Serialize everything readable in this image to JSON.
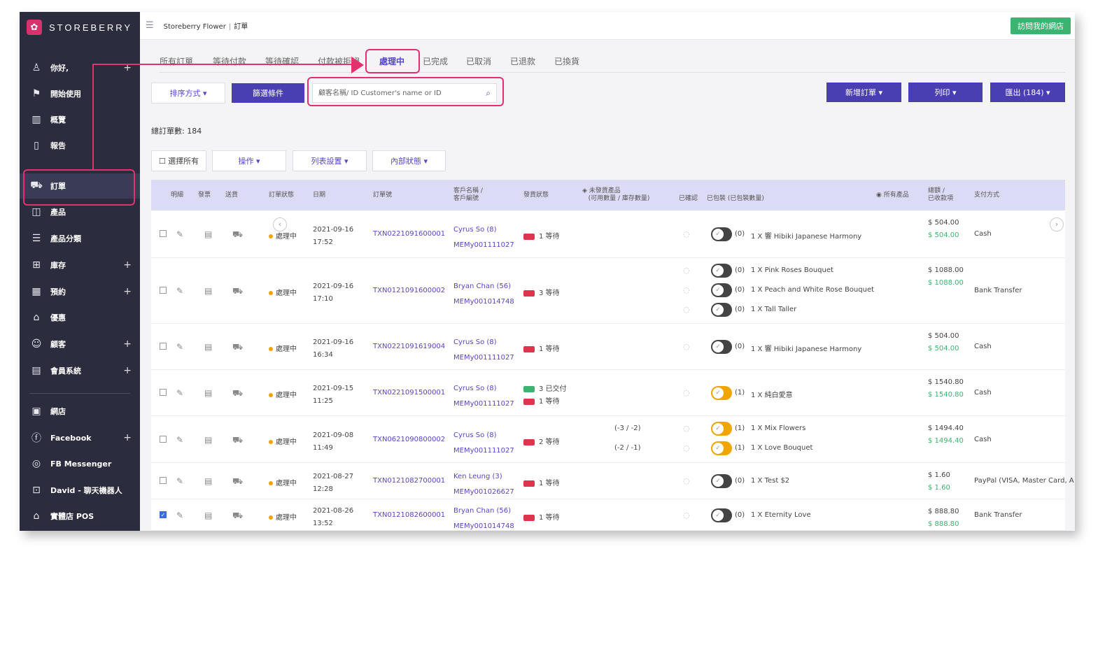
{
  "brand": {
    "name": "STOREBERRY",
    "logo_icon": "flower-logo"
  },
  "header": {
    "breadcrumb_store": "Storeberry Flower",
    "breadcrumb_page": "訂單",
    "visit_button": "訪問我的網店"
  },
  "sidebar": {
    "items": [
      {
        "label": "你好,",
        "icon": "user-icon",
        "plus": true
      },
      {
        "label": "開始使用",
        "icon": "flag-icon",
        "plus": false
      },
      {
        "label": "概覽",
        "icon": "chart-icon",
        "plus": false
      },
      {
        "label": "報告",
        "icon": "document-icon",
        "plus": false
      },
      {
        "label": "訂單",
        "icon": "cart-icon",
        "plus": false,
        "active": true
      },
      {
        "label": "產品",
        "icon": "bag-icon",
        "plus": false
      },
      {
        "label": "產品分類",
        "icon": "list-icon",
        "plus": false
      },
      {
        "label": "庫存",
        "icon": "boxes-icon",
        "plus": true
      },
      {
        "label": "預約",
        "icon": "calendar-icon",
        "plus": true
      },
      {
        "label": "優惠",
        "icon": "home-icon",
        "plus": false
      },
      {
        "label": "顧客",
        "icon": "customer-icon",
        "plus": true
      },
      {
        "label": "會員系統",
        "icon": "member-icon",
        "plus": true
      },
      {
        "label": "網店",
        "icon": "save-icon",
        "plus": false
      },
      {
        "label": "Facebook",
        "icon": "facebook-icon",
        "plus": true
      },
      {
        "label": "FB Messenger",
        "icon": "messenger-icon",
        "plus": false
      },
      {
        "label": "David - 聊天機器人",
        "icon": "robot-icon",
        "plus": false
      },
      {
        "label": "實體店 POS",
        "icon": "shop-icon",
        "plus": false
      }
    ]
  },
  "tabs": [
    {
      "label": "所有訂單"
    },
    {
      "label": "等待付款"
    },
    {
      "label": "等待確認"
    },
    {
      "label": "付款被拒絕"
    },
    {
      "label": "處理中",
      "active": true
    },
    {
      "label": "已完成"
    },
    {
      "label": "已取消"
    },
    {
      "label": "已退款"
    },
    {
      "label": "已換貨"
    }
  ],
  "toolbar": {
    "sort_label": "排序方式 ▾",
    "filter_label": "篩選條件",
    "search_placeholder": "顧客名稱/ ID Customer's name or ID",
    "new_order": "新增訂單 ▾",
    "print": "列印 ▾",
    "export": "匯出 (184) ▾"
  },
  "total_orders": "總訂單數: 184",
  "actions": {
    "select_all": "☐ 選擇所有",
    "operation": "操作 ▾",
    "list_settings": "列表設置 ▾",
    "internal_status": "內部狀態 ▾"
  },
  "table": {
    "headers": {
      "detail": "明細",
      "invoice": "發票",
      "delivery": "送貨",
      "status": "訂單狀態",
      "date": "日期",
      "order_no": "訂單號",
      "customer_1": "客戶名稱 /",
      "customer_2": "客戶編號",
      "shipping": "發貨狀態",
      "unshipped_1": "未發貨產品",
      "unshipped_2": "(可用數量 / 庫存數量)",
      "confirmed": "已確認",
      "packed": "已包裝 (已包裝數量)",
      "all_products": "所有產品",
      "total_1": "總額 /",
      "total_2": "已收款項",
      "payment": "支付方式"
    },
    "rows": [
      {
        "checked": false,
        "status": "處理中",
        "date": "2021-09-16",
        "time": "17:52",
        "order": "TXN0221091600001",
        "customer": "Cyrus So (8)",
        "member": "MEMy001111027",
        "ship": [
          {
            "text": "1 等待",
            "color": "red"
          }
        ],
        "items": [
          {
            "qty": "(0)",
            "name": "1 X 響 Hibiki Japanese Harmony",
            "on": false,
            "unshipped": ""
          }
        ],
        "total": "$ 504.00",
        "paid": "$ 504.00",
        "payment": "Cash"
      },
      {
        "checked": false,
        "status": "處理中",
        "date": "2021-09-16",
        "time": "17:10",
        "order": "TXN0121091600002",
        "customer": "Bryan Chan (56)",
        "member": "MEMy001014748",
        "ship": [
          {
            "text": "3 等待",
            "color": "red"
          }
        ],
        "items": [
          {
            "qty": "(0)",
            "name": "1 X Pink Roses Bouquet",
            "on": false,
            "unshipped": ""
          },
          {
            "qty": "(0)",
            "name": "1 X Peach and White Rose Bouquet",
            "on": false,
            "unshipped": ""
          },
          {
            "qty": "(0)",
            "name": "1 X Tall Taller",
            "on": false,
            "unshipped": ""
          }
        ],
        "total": "$ 1088.00",
        "paid": "$ 1088.00",
        "payment": "Bank Transfer"
      },
      {
        "checked": false,
        "status": "處理中",
        "date": "2021-09-16",
        "time": "16:34",
        "order": "TXN0221091619004",
        "customer": "Cyrus So (8)",
        "member": "MEMy001111027",
        "ship": [
          {
            "text": "1 等待",
            "color": "red"
          }
        ],
        "items": [
          {
            "qty": "(0)",
            "name": "1 X 響 Hibiki Japanese Harmony",
            "on": false,
            "unshipped": ""
          }
        ],
        "total": "$ 504.00",
        "paid": "$ 504.00",
        "payment": "Cash"
      },
      {
        "checked": false,
        "status": "處理中",
        "date": "2021-09-15",
        "time": "11:25",
        "order": "TXN0221091500001",
        "customer": "Cyrus So (8)",
        "member": "MEMy001111027",
        "ship": [
          {
            "text": "3 已交付",
            "color": "green"
          },
          {
            "text": "1 等待",
            "color": "red"
          }
        ],
        "items": [
          {
            "qty": "(1)",
            "name": "1 X 純白愛意",
            "on": true,
            "unshipped": ""
          }
        ],
        "total": "$ 1540.80",
        "paid": "$ 1540.80",
        "payment": "Cash"
      },
      {
        "checked": false,
        "status": "處理中",
        "date": "2021-09-08",
        "time": "11:49",
        "order": "TXN0621090800002",
        "customer": "Cyrus So (8)",
        "member": "MEMy001111027",
        "ship": [
          {
            "text": "2 等待",
            "color": "red"
          }
        ],
        "items": [
          {
            "qty": "(1)",
            "name": "1 X Mix Flowers",
            "on": true,
            "unshipped": "(-3 / -2)"
          },
          {
            "qty": "(1)",
            "name": "1 X Love Bouquet",
            "on": true,
            "unshipped": "(-2 / -1)"
          }
        ],
        "total": "$ 1494.40",
        "paid": "$ 1494.40",
        "payment": "Cash"
      },
      {
        "checked": false,
        "status": "處理中",
        "date": "2021-08-27",
        "time": "12:28",
        "order": "TXN0121082700001",
        "customer": "Ken Leung (3)",
        "member": "MEMy001026627",
        "ship": [
          {
            "text": "1 等待",
            "color": "red"
          }
        ],
        "items": [
          {
            "qty": "(0)",
            "name": "1 X Test $2",
            "on": false,
            "unshipped": ""
          }
        ],
        "total": "$ 1.60",
        "paid": "$ 1.60",
        "payment": "PayPal (VISA, Master Card, A"
      },
      {
        "checked": true,
        "status": "處理中",
        "date": "2021-08-26",
        "time": "13:52",
        "order": "TXN0121082600001",
        "customer": "Bryan Chan (56)",
        "member": "MEMy001014748",
        "ship": [
          {
            "text": "1 等待",
            "color": "red"
          }
        ],
        "items": [
          {
            "qty": "(0)",
            "name": "1 X Eternity Love",
            "on": false,
            "unshipped": ""
          }
        ],
        "total": "$ 888.80",
        "paid": "$ 888.80",
        "payment": "Bank Transfer"
      }
    ]
  },
  "colors": {
    "sidebar": "#2b2d3e",
    "accent": "#4a3fb2",
    "highlight": "#e0336e",
    "paid": "#3cb371",
    "status_dot": "#f0a500"
  }
}
